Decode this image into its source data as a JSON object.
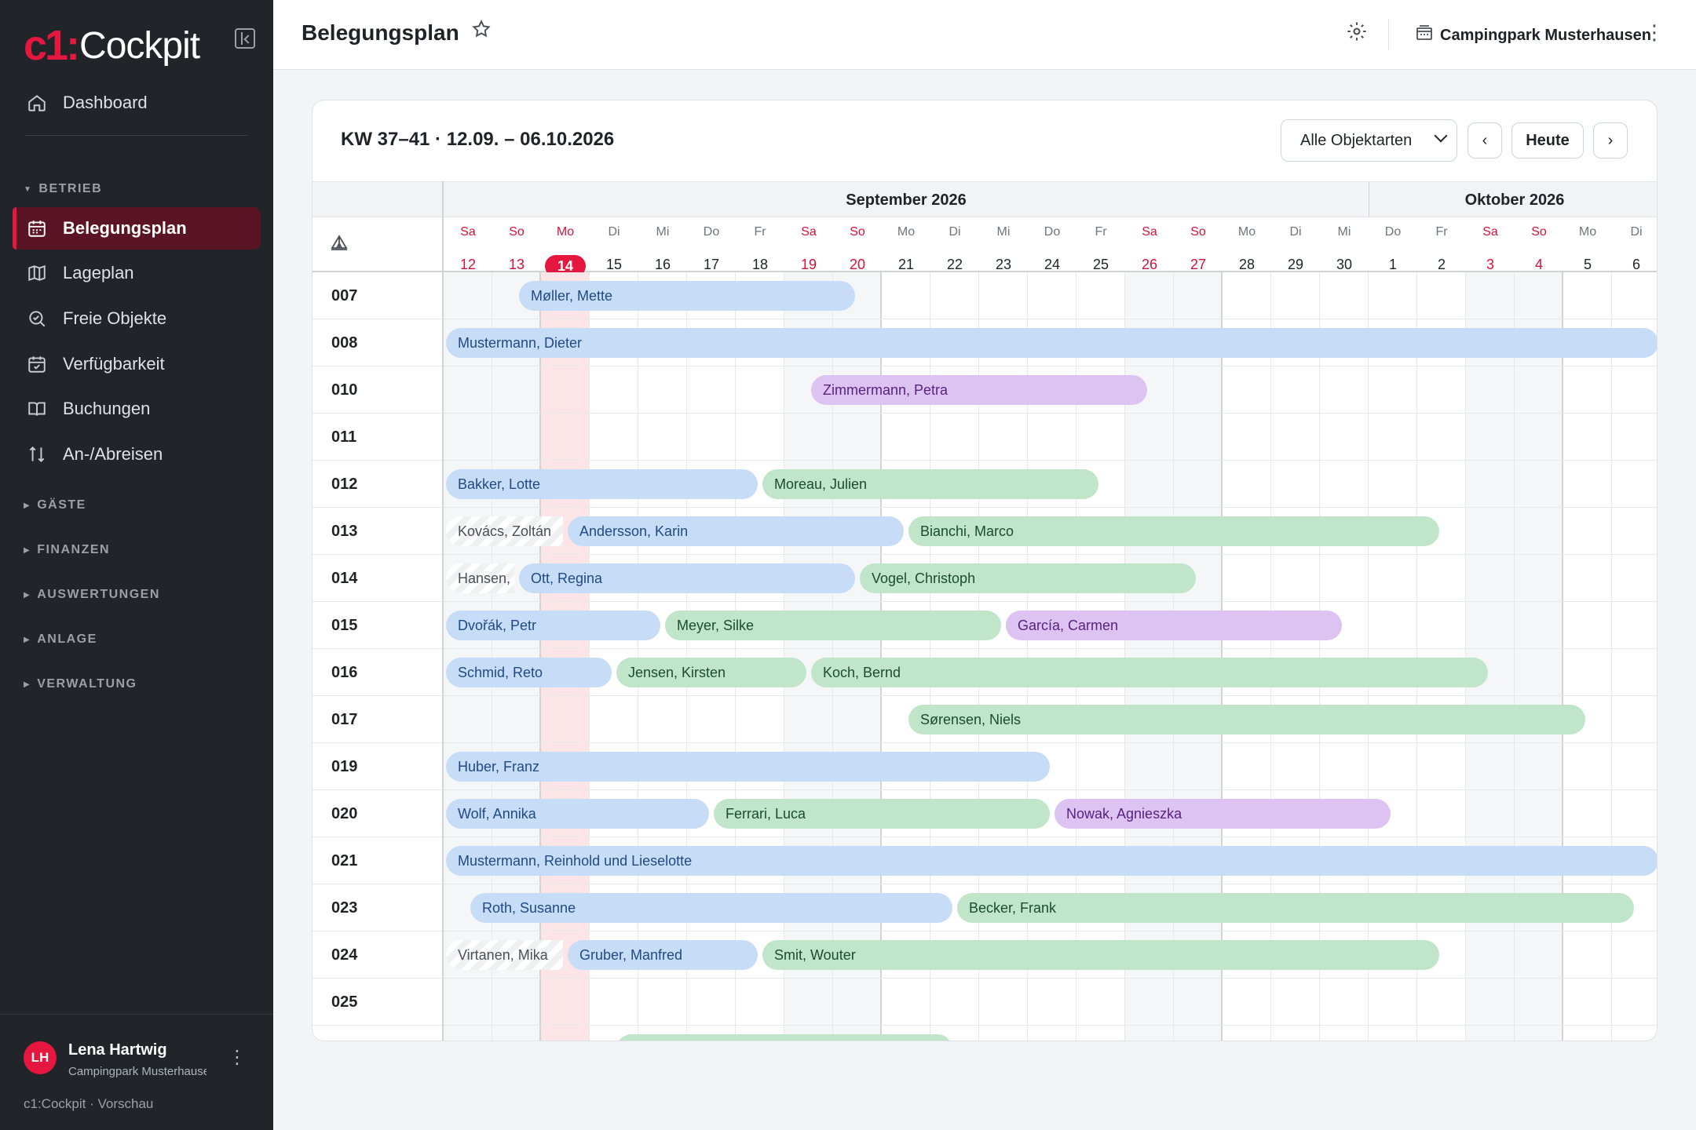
{
  "app": {
    "logo_mark": "c1:",
    "logo_word": "Cockpit",
    "version_label": "c1:Cockpit · Vorschau"
  },
  "sidebar": {
    "top": {
      "label": "Dashboard",
      "icon": "home-icon"
    },
    "sections": [
      {
        "label": "BETRIEB",
        "expanded": true
      },
      {
        "label": "GÄSTE",
        "expanded": false
      },
      {
        "label": "FINANZEN",
        "expanded": false
      },
      {
        "label": "AUSWERTUNGEN",
        "expanded": false
      },
      {
        "label": "ANLAGE",
        "expanded": false
      },
      {
        "label": "VERWALTUNG",
        "expanded": false
      }
    ],
    "items": [
      {
        "label": "Belegungsplan",
        "icon": "calendar-icon",
        "active": true
      },
      {
        "label": "Lageplan",
        "icon": "map-icon"
      },
      {
        "label": "Freie Objekte",
        "icon": "search-icon"
      },
      {
        "label": "Verfügbarkeit",
        "icon": "calendar-check-icon"
      },
      {
        "label": "Buchungen",
        "icon": "book-icon"
      },
      {
        "label": "An-/Abreisen",
        "icon": "arrows-updown-icon"
      }
    ]
  },
  "user": {
    "initials": "LH",
    "name": "Lena Hartwig",
    "org": "Campingpark Musterhausen"
  },
  "header": {
    "title": "Belegungsplan",
    "campsite": "Campingpark Musterhausen"
  },
  "plan": {
    "range_title": "KW 37–41 · 12.09. – 06.10.2026",
    "filter_value": "Alle Objektarten",
    "today_label": "Heute",
    "prev_label": "‹",
    "next_label": "›",
    "months": [
      "September 2026",
      "Oktober 2026"
    ],
    "days": [
      {
        "n": "Sa",
        "d": "12",
        "we": true
      },
      {
        "n": "So",
        "d": "13",
        "we": true
      },
      {
        "n": "Mo",
        "d": "14",
        "today": true
      },
      {
        "n": "Di",
        "d": "15"
      },
      {
        "n": "Mi",
        "d": "16"
      },
      {
        "n": "Do",
        "d": "17"
      },
      {
        "n": "Fr",
        "d": "18"
      },
      {
        "n": "Sa",
        "d": "19",
        "we": true
      },
      {
        "n": "So",
        "d": "20",
        "we": true
      },
      {
        "n": "Mo",
        "d": "21"
      },
      {
        "n": "Di",
        "d": "22"
      },
      {
        "n": "Mi",
        "d": "23"
      },
      {
        "n": "Do",
        "d": "24"
      },
      {
        "n": "Fr",
        "d": "25"
      },
      {
        "n": "Sa",
        "d": "26",
        "we": true
      },
      {
        "n": "So",
        "d": "27",
        "we": true
      },
      {
        "n": "Mo",
        "d": "28"
      },
      {
        "n": "Di",
        "d": "29"
      },
      {
        "n": "Mi",
        "d": "30"
      },
      {
        "n": "Do",
        "d": "1"
      },
      {
        "n": "Fr",
        "d": "2"
      },
      {
        "n": "Sa",
        "d": "3",
        "we": true
      },
      {
        "n": "So",
        "d": "4",
        "we": true
      },
      {
        "n": "Mo",
        "d": "5"
      },
      {
        "n": "Di",
        "d": "6"
      }
    ],
    "rows": [
      {
        "id": "007",
        "bookings": [
          {
            "name": "Møller, Mette",
            "start": 1.5,
            "end": 8.5,
            "color": "blue"
          }
        ]
      },
      {
        "id": "008",
        "bookings": [
          {
            "name": "Mustermann, Dieter",
            "start": 0,
            "end": 25,
            "color": "blue"
          }
        ]
      },
      {
        "id": "010",
        "bookings": [
          {
            "name": "Zimmermann, Petra",
            "start": 7.5,
            "end": 14.5,
            "color": "purple"
          }
        ]
      },
      {
        "id": "011",
        "bookings": []
      },
      {
        "id": "012",
        "bookings": [
          {
            "name": "Bakker, Lotte",
            "start": 0,
            "end": 6.5,
            "color": "blue"
          },
          {
            "name": "Moreau, Julien",
            "start": 6.5,
            "end": 13.5,
            "color": "green"
          }
        ]
      },
      {
        "id": "013",
        "bookings": [
          {
            "name": "Kovács, Zoltán",
            "start": 0,
            "end": 2.5,
            "color": "gray"
          },
          {
            "name": "Andersson, Karin",
            "start": 2.5,
            "end": 9.5,
            "color": "blue"
          },
          {
            "name": "Bianchi, Marco",
            "start": 9.5,
            "end": 20.5,
            "color": "green"
          }
        ]
      },
      {
        "id": "014",
        "bookings": [
          {
            "name": "Hansen, Ole",
            "start": 0,
            "end": 1.5,
            "color": "gray"
          },
          {
            "name": "Ott, Regina",
            "start": 1.5,
            "end": 8.5,
            "color": "blue"
          },
          {
            "name": "Vogel, Christoph",
            "start": 8.5,
            "end": 15.5,
            "color": "green"
          }
        ]
      },
      {
        "id": "015",
        "bookings": [
          {
            "name": "Dvořák, Petr",
            "start": 0,
            "end": 4.5,
            "color": "blue"
          },
          {
            "name": "Meyer, Silke",
            "start": 4.5,
            "end": 11.5,
            "color": "green"
          },
          {
            "name": "García, Carmen",
            "start": 11.5,
            "end": 18.5,
            "color": "purple"
          }
        ]
      },
      {
        "id": "016",
        "bookings": [
          {
            "name": "Schmid, Reto",
            "start": 0,
            "end": 3.5,
            "color": "blue"
          },
          {
            "name": "Jensen, Kirsten",
            "start": 3.5,
            "end": 7.5,
            "color": "green"
          },
          {
            "name": "Koch, Bernd",
            "start": 7.5,
            "end": 21.5,
            "color": "green"
          }
        ]
      },
      {
        "id": "017",
        "bookings": [
          {
            "name": "Sørensen, Niels",
            "start": 9.5,
            "end": 23.5,
            "color": "green"
          }
        ]
      },
      {
        "id": "019",
        "bookings": [
          {
            "name": "Huber, Franz",
            "start": 0,
            "end": 12.5,
            "color": "blue"
          }
        ]
      },
      {
        "id": "020",
        "bookings": [
          {
            "name": "Wolf, Annika",
            "start": 0,
            "end": 5.5,
            "color": "blue"
          },
          {
            "name": "Ferrari, Luca",
            "start": 5.5,
            "end": 12.5,
            "color": "green"
          },
          {
            "name": "Nowak, Agnieszka",
            "start": 12.5,
            "end": 19.5,
            "color": "purple"
          }
        ]
      },
      {
        "id": "021",
        "bookings": [
          {
            "name": "Mustermann, Reinhold und Lieselotte",
            "start": 0,
            "end": 25,
            "color": "blue"
          }
        ]
      },
      {
        "id": "023",
        "bookings": [
          {
            "name": "Roth, Susanne",
            "start": 0.5,
            "end": 10.5,
            "color": "blue"
          },
          {
            "name": "Becker, Frank",
            "start": 10.5,
            "end": 24.5,
            "color": "green"
          }
        ]
      },
      {
        "id": "024",
        "bookings": [
          {
            "name": "Virtanen, Mika",
            "start": 0,
            "end": 2.5,
            "color": "gray"
          },
          {
            "name": "Gruber, Manfred",
            "start": 2.5,
            "end": 6.5,
            "color": "blue"
          },
          {
            "name": "Smit, Wouter",
            "start": 6.5,
            "end": 20.5,
            "color": "green"
          }
        ]
      },
      {
        "id": "025",
        "bookings": []
      },
      {
        "id": "",
        "bookings": [
          {
            "name": "",
            "start": 3.5,
            "end": 10.5,
            "color": "green"
          }
        ]
      }
    ]
  },
  "colors": {
    "accent": "#e5173f",
    "sidebar_bg": "#212529",
    "blue": "#c7dcf7",
    "green": "#c0e5c9",
    "purple": "#dcc3f1"
  }
}
